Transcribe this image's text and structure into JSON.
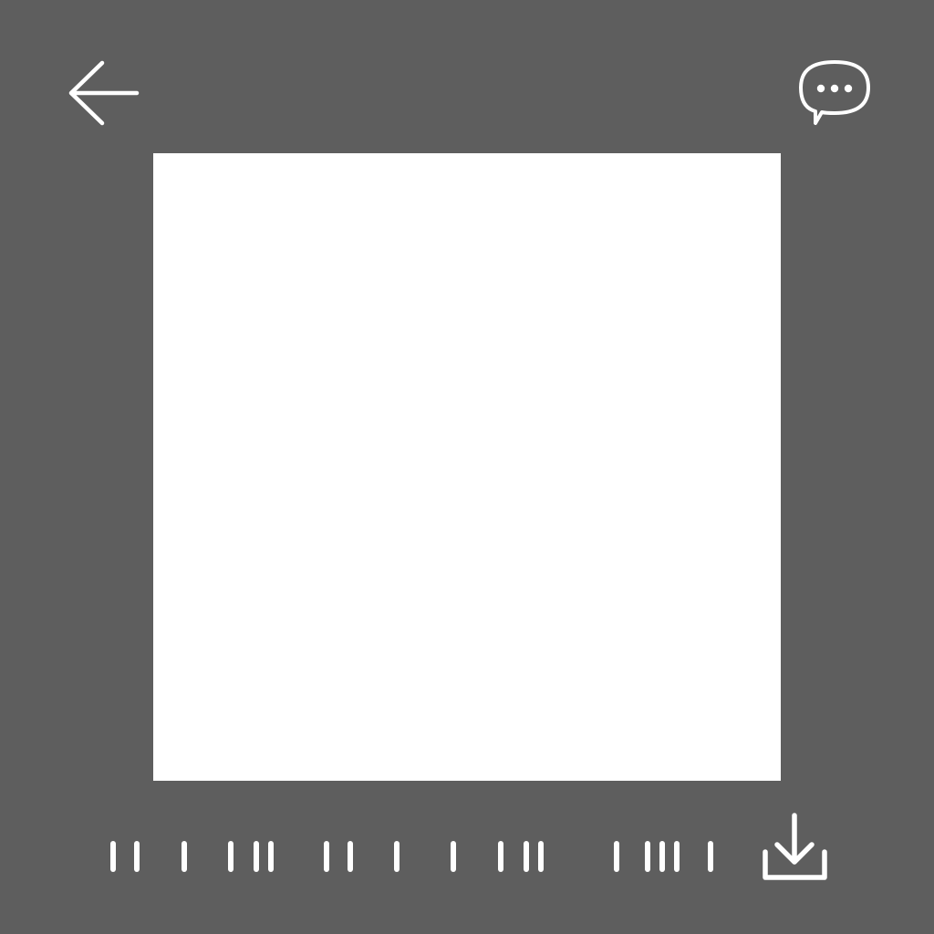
{
  "header": {
    "back_icon": "arrow-left-icon",
    "comment_icon": "chat-bubble-ellipsis-icon"
  },
  "main": {
    "image": {
      "background": "#ffffff"
    }
  },
  "footer": {
    "barcode_icon": "barcode-icon",
    "download_icon": "download-icon"
  },
  "colors": {
    "background": "#5e5e5e",
    "foreground": "#ffffff"
  }
}
